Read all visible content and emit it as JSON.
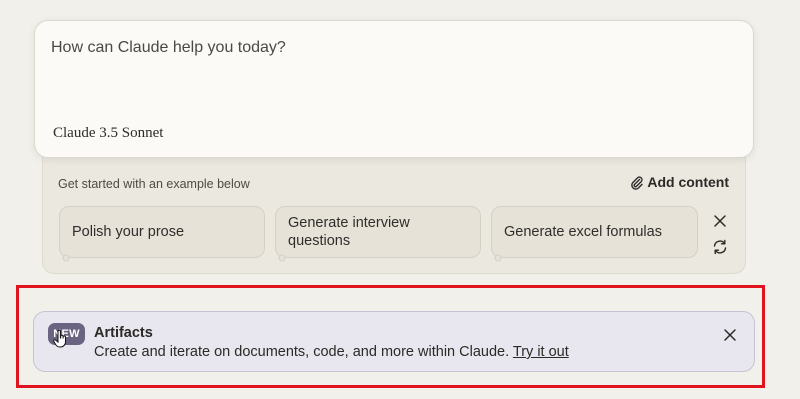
{
  "composer": {
    "placeholder": "How can Claude help you today?",
    "model_brand": "Claude",
    "model_version": "3.5 Sonnet"
  },
  "starters": {
    "caption": "Get started with an example below",
    "add_content_label": "Add content",
    "add_content_icon": "paperclip-icon",
    "items": [
      {
        "label": "Polish your prose"
      },
      {
        "label": "Generate interview questions"
      },
      {
        "label": "Generate excel formulas"
      }
    ],
    "close_icon": "close-icon",
    "refresh_icon": "refresh-icon"
  },
  "banner": {
    "badge": "NEW",
    "title": "Artifacts",
    "description": "Create and iterate on documents, code, and more within Claude.",
    "link_text": "Try it out",
    "close_icon": "close-icon"
  },
  "colors": {
    "page_bg": "#f2f0ea",
    "highlight": "#e0141e",
    "badge_bg": "#6b6480",
    "banner_bg": "#e8e6ee"
  }
}
